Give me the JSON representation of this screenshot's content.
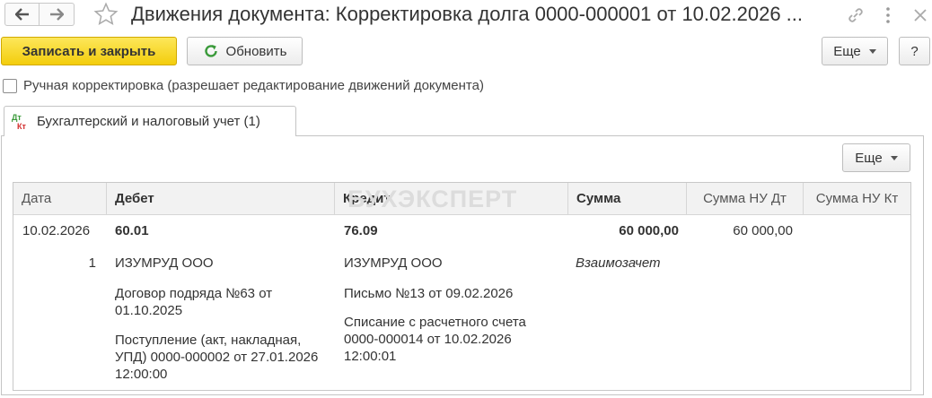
{
  "window": {
    "title": "Движения документа: Корректировка долга 0000-000001 от 10.02.2026 ..."
  },
  "toolbar": {
    "save_close_label": "Записать и закрыть",
    "refresh_label": "Обновить",
    "more_label": "Еще",
    "help_label": "?"
  },
  "manual_edit": {
    "label": "Ручная корректировка (разрешает редактирование движений документа)",
    "checked": false
  },
  "tab": {
    "icon_top": "Дт",
    "icon_bottom": "Кт",
    "label": "Бухгалтерский и налоговый учет (1)"
  },
  "table_toolbar": {
    "more_label": "Еще"
  },
  "watermark": "БУХЭКСПЕРТ",
  "table": {
    "columns": [
      "Дата",
      "Дебет",
      "Кредит",
      "Сумма",
      "Сумма НУ Дт",
      "Сумма НУ Кт"
    ],
    "row": {
      "date": "10.02.2026",
      "line_no": "1",
      "debit_account": "60.01",
      "debit_sub1": "ИЗУМРУД ООО",
      "debit_sub2": "Договор подряда №63 от 01.10.2025",
      "debit_sub3": "Поступление (акт, накладная, УПД) 0000-000002 от 27.01.2026 12:00:00",
      "credit_account": "76.09",
      "credit_sub1": "ИЗУМРУД ООО",
      "credit_sub2": "Письмо №13 от 09.02.2026",
      "credit_sub3": "Списание с расчетного счета 0000-000014 от 10.02.2026 12:00:01",
      "amount": "60 000,00",
      "content": "Взаимозачет",
      "amount_nu_dt": "60 000,00",
      "amount_nu_kt": ""
    }
  },
  "colors": {
    "primary_button": "#f5d11c",
    "refresh_icon": "#3a9a3a",
    "dt_label": "#3a9a3a",
    "kt_label": "#d32f2f"
  }
}
